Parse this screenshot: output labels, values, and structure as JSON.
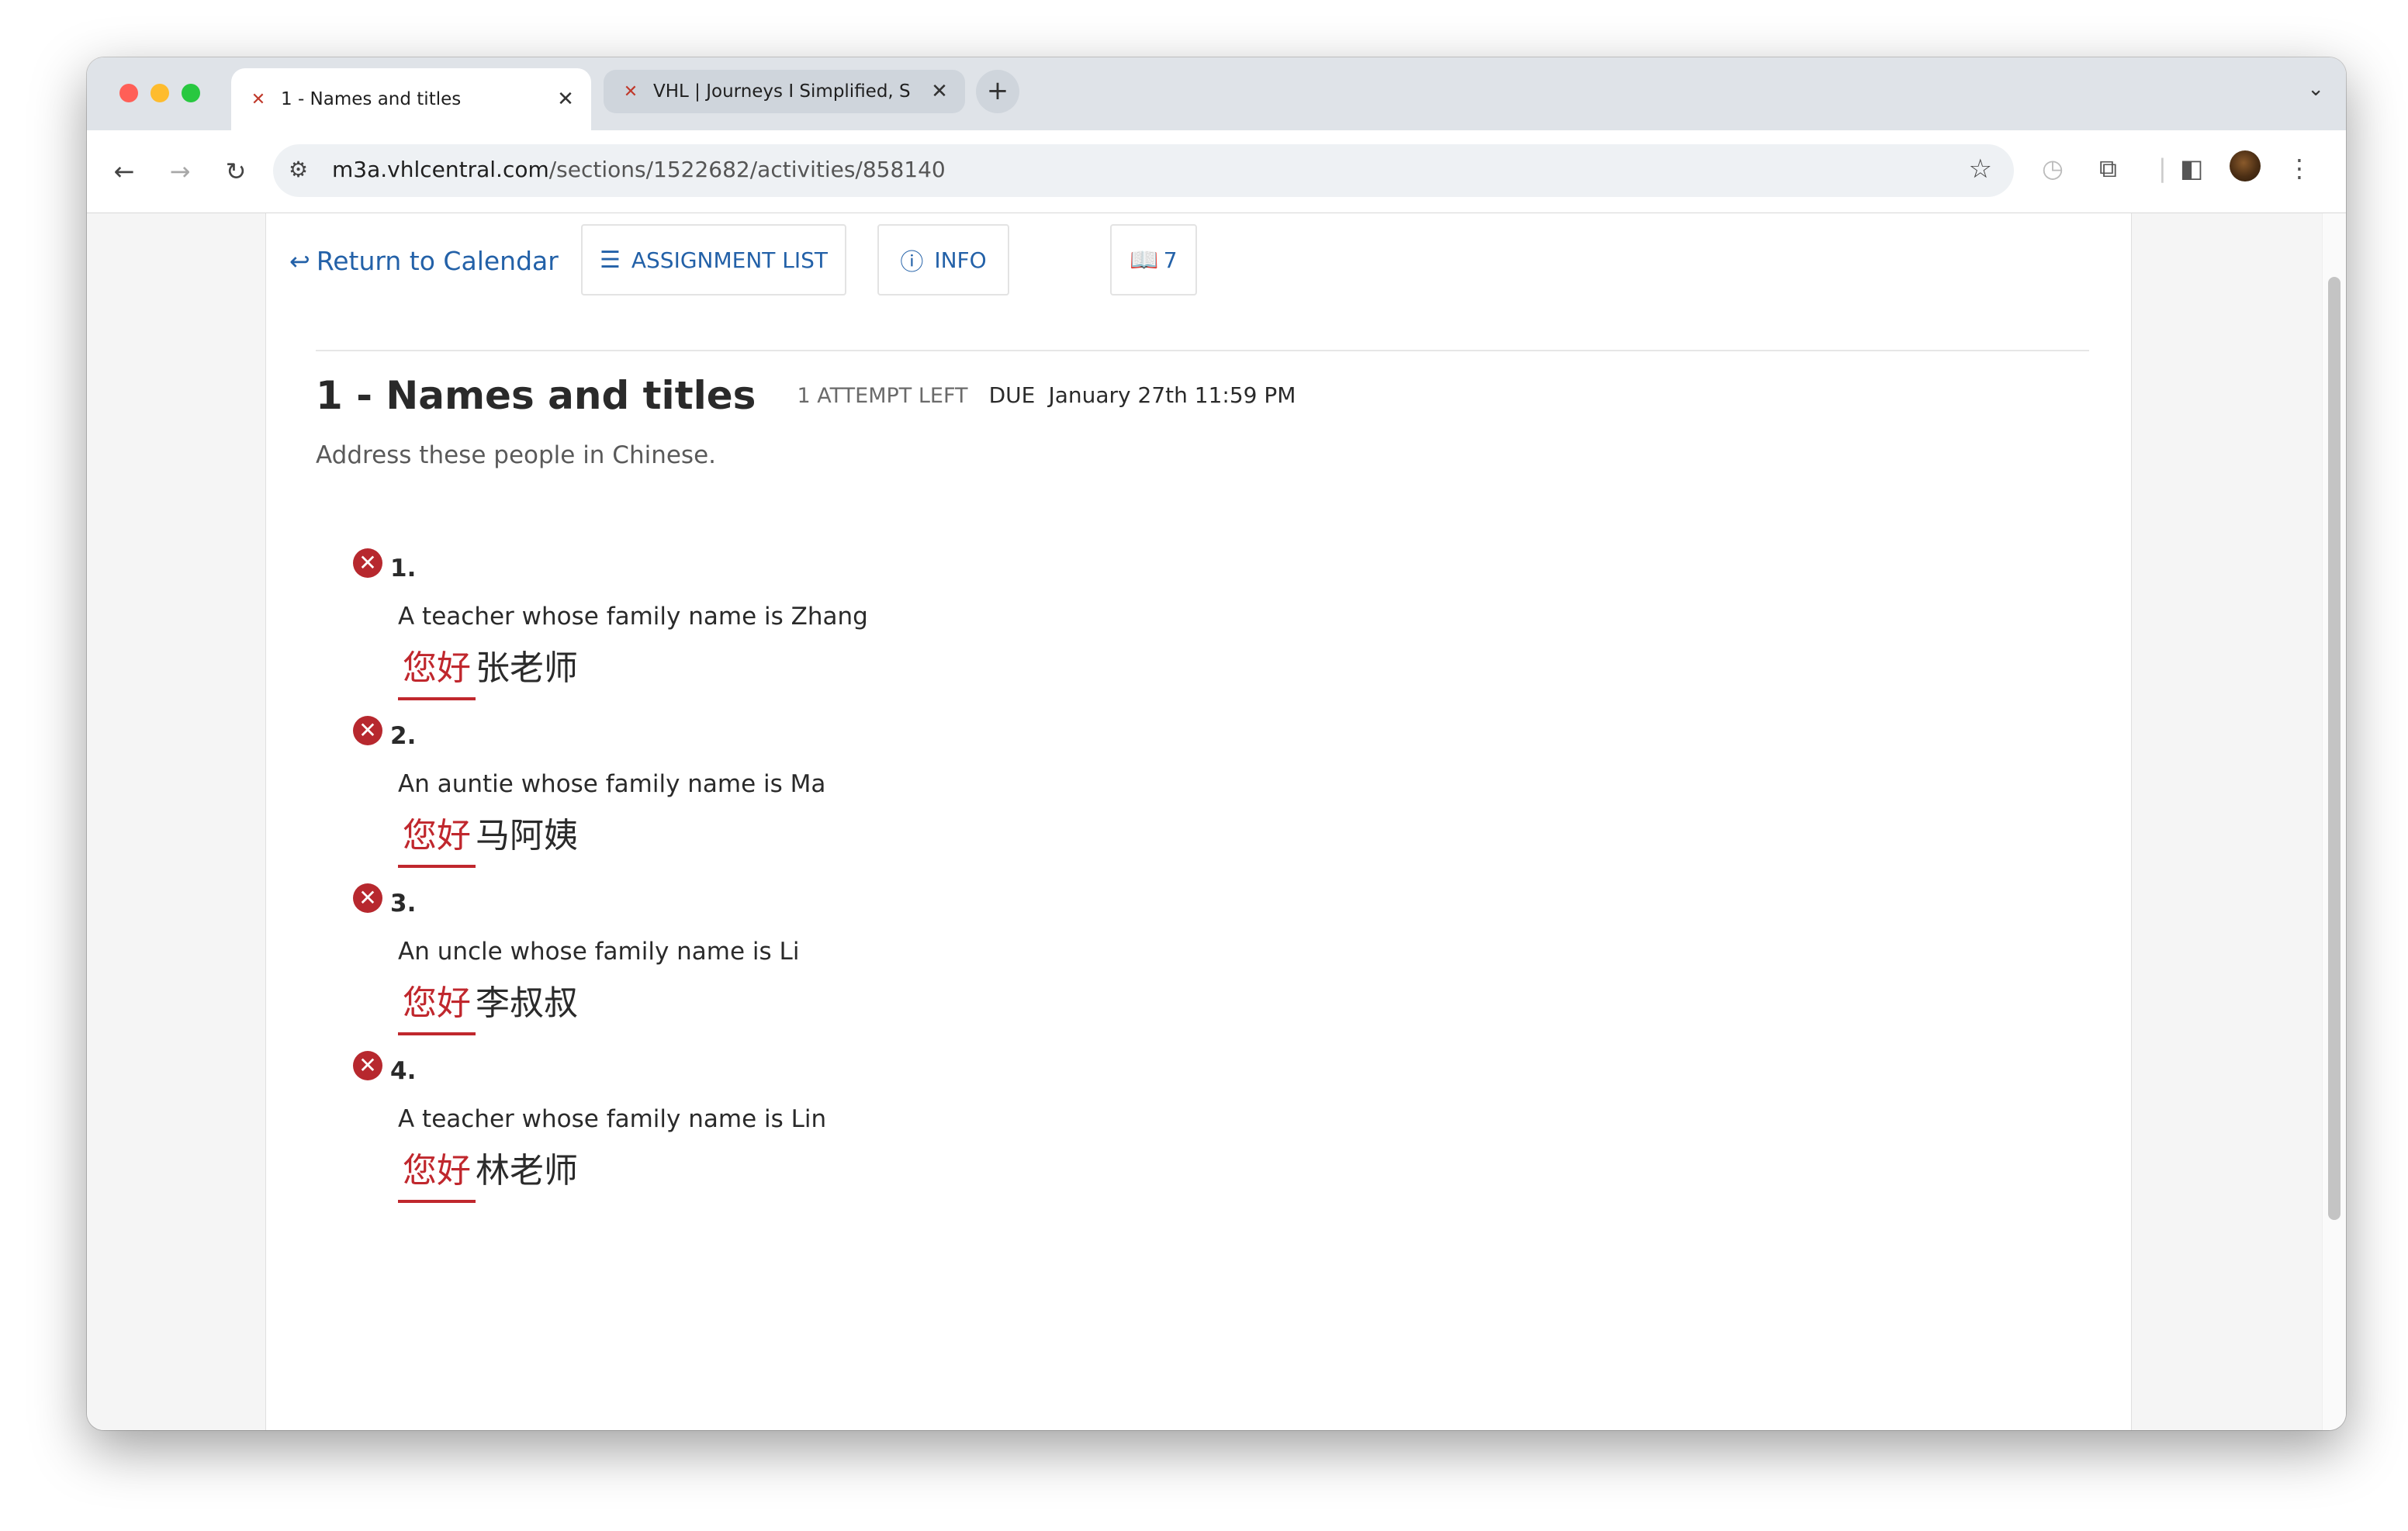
{
  "browser": {
    "tabs": [
      {
        "title": "1 - Names and titles",
        "active": true
      },
      {
        "title": "VHL | Journeys I Simplified, S",
        "active": false
      }
    ],
    "new_tab_label": "+",
    "url_host": "m3a.vhlcentral.com",
    "url_path": "/sections/1522682/activities/858140"
  },
  "nav": {
    "return_label": "Return to Calendar",
    "assignment_list_label": "ASSIGNMENT LIST",
    "info_label": "INFO",
    "book_count": "7"
  },
  "activity": {
    "title": "1 - Names and titles",
    "attempts": "1 ATTEMPT LEFT",
    "due_label": "DUE",
    "due_date": "January 27th 11:59 PM",
    "instructions": "Address these people in Chinese."
  },
  "questions": [
    {
      "number": "1.",
      "status": "incorrect",
      "prompt": "A teacher whose family name is Zhang",
      "answer_wrong": "您好",
      "answer_rest": "张老师"
    },
    {
      "number": "2.",
      "status": "incorrect",
      "prompt": "An auntie whose family name is Ma",
      "answer_wrong": "您好",
      "answer_rest": "马阿姨"
    },
    {
      "number": "3.",
      "status": "incorrect",
      "prompt": "An uncle whose family name is Li",
      "answer_wrong": "您好",
      "answer_rest": "李叔叔"
    },
    {
      "number": "4.",
      "status": "incorrect",
      "prompt": "A teacher whose family name is Lin",
      "answer_wrong": "您好",
      "answer_rest": "林老师"
    }
  ],
  "colors": {
    "link": "#2361a8",
    "error": "#c0272d",
    "primary_button": "#2c63a8"
  }
}
